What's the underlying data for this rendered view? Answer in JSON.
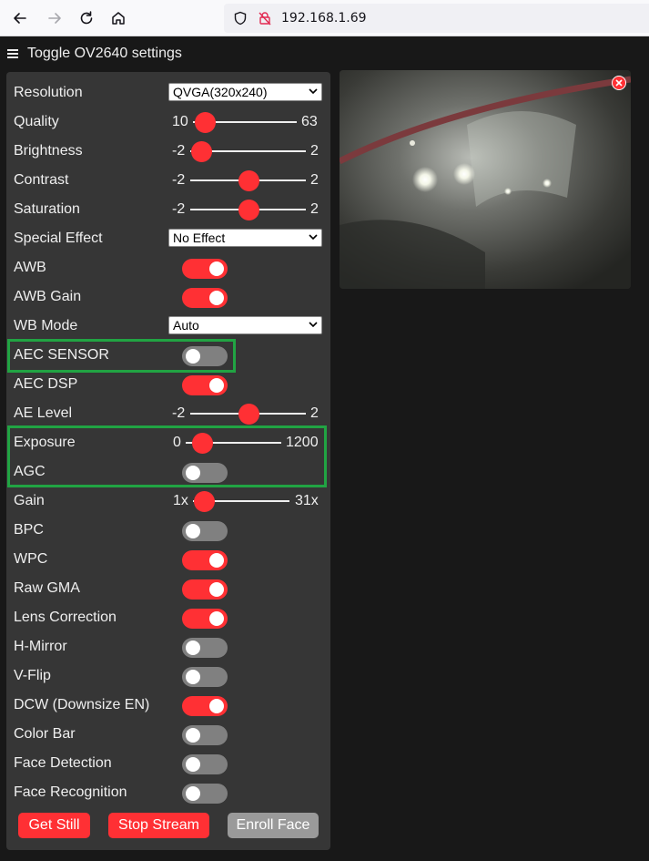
{
  "browser": {
    "url": "192.168.1.69"
  },
  "header": {
    "menu_label": "Toggle OV2640 settings"
  },
  "settings": {
    "resolution": {
      "label": "Resolution",
      "value": "QVGA(320x240)"
    },
    "quality": {
      "label": "Quality",
      "min": "10",
      "max": "63",
      "value": 10
    },
    "brightness": {
      "label": "Brightness",
      "min": "-2",
      "max": "2",
      "value": -2
    },
    "contrast": {
      "label": "Contrast",
      "min": "-2",
      "max": "2",
      "value": 0
    },
    "saturation": {
      "label": "Saturation",
      "min": "-2",
      "max": "2",
      "value": 0
    },
    "special_effect": {
      "label": "Special Effect",
      "value": "No Effect"
    },
    "awb": {
      "label": "AWB",
      "on": true
    },
    "awb_gain": {
      "label": "AWB Gain",
      "on": true
    },
    "wb_mode": {
      "label": "WB Mode",
      "value": "Auto"
    },
    "aec_sensor": {
      "label": "AEC SENSOR",
      "on": false
    },
    "aec_dsp": {
      "label": "AEC DSP",
      "on": true
    },
    "ae_level": {
      "label": "AE Level",
      "min": "-2",
      "max": "2",
      "value": 0
    },
    "exposure": {
      "label": "Exposure",
      "min": "0",
      "max": "1200",
      "value": 120
    },
    "agc": {
      "label": "AGC",
      "on": false
    },
    "gain": {
      "label": "Gain",
      "min": "1x",
      "max": "31x",
      "value": 1
    },
    "bpc": {
      "label": "BPC",
      "on": false
    },
    "wpc": {
      "label": "WPC",
      "on": true
    },
    "raw_gma": {
      "label": "Raw GMA",
      "on": true
    },
    "lens_correction": {
      "label": "Lens Correction",
      "on": true
    },
    "h_mirror": {
      "label": "H-Mirror",
      "on": false
    },
    "v_flip": {
      "label": "V-Flip",
      "on": false
    },
    "dcw": {
      "label": "DCW (Downsize EN)",
      "on": true
    },
    "color_bar": {
      "label": "Color Bar",
      "on": false
    },
    "face_detection": {
      "label": "Face Detection",
      "on": false
    },
    "face_recognition": {
      "label": "Face Recognition",
      "on": false
    }
  },
  "buttons": {
    "get_still": "Get Still",
    "stop_stream": "Stop Stream",
    "enroll_face": "Enroll Face"
  },
  "colors": {
    "accent": "#ff3034",
    "highlight": "#21a443",
    "panel": "#363636",
    "background": "#181818"
  },
  "icons": [
    "back-arrow-icon",
    "forward-arrow-icon",
    "reload-icon",
    "home-icon",
    "shield-icon",
    "insecure-lock-icon",
    "hamburger-icon",
    "close-icon"
  ]
}
